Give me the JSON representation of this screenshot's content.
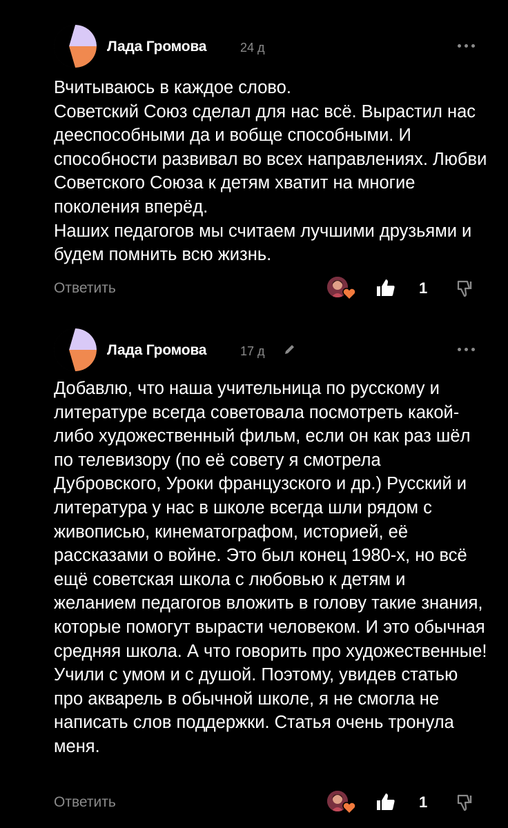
{
  "comments": [
    {
      "author": "Лада Громова",
      "time": "24 д",
      "edited": false,
      "text": "Вчитываюсь в каждое слово.\nСоветский Союз сделал для нас всё. Вырастил нас дееспособными да и вобще способными. И способности развивал во всех направлениях. Любви Советского Союза к детям хватит на многие поколения вперёд.\nНаших педагогов мы считаем лучшими друзьями и будем помнить всю жизнь.",
      "reply_label": "Ответить",
      "likes": "1"
    },
    {
      "author": "Лада Громова",
      "time": "17 д",
      "edited": true,
      "text": "Добавлю, что наша учительница по русскому и литературе всегда советовала посмотреть какой-либо художественный фильм, если он как раз шёл по телевизору (по её совету я смотрела Дубровского, Уроки французского и др.) Русский и литература у нас в школе всегда шли рядом с живописью, кинематографом, историей, её рассказами о войне. Это был конец 1980-х, но всё ещё советская школа с любовью к детям и желанием педагогов вложить в голову такие знания, которые помогут вырасти человеком. И это обычная средняя школа. А что говорить про художественные! Учили с умом и с душой. Поэтому, увидев статью про акварель в обычной школе, я не смогла не написать слов поддержки. Статья очень тронула меня.",
      "reply_label": "Ответить",
      "likes": "1"
    }
  ],
  "colors": {
    "background": "#000000",
    "text": "#ffffff",
    "muted": "#8a8a8a",
    "avatar_purple": "#d9c9f7",
    "avatar_orange": "#f0894f",
    "heart": "#f27a3d"
  },
  "icons": [
    "avatar-logo",
    "more-icon",
    "edit-icon",
    "heart-icon",
    "like-icon",
    "dislike-icon"
  ]
}
